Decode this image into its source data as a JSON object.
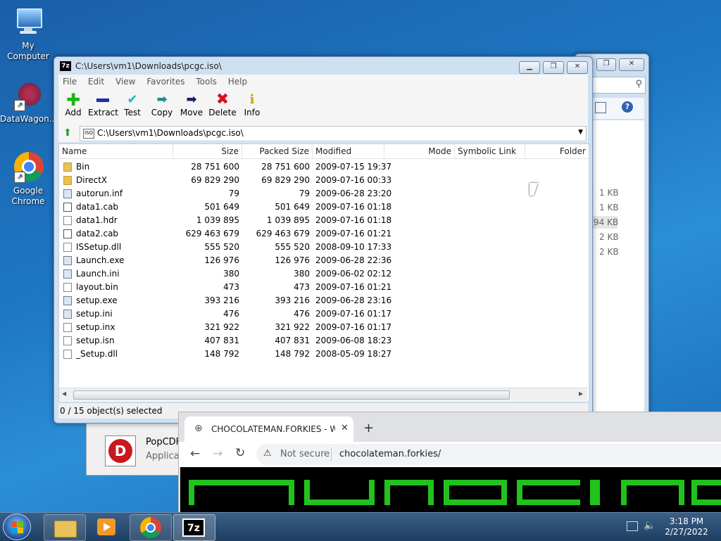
{
  "desktop": {
    "icons": [
      {
        "label": "My Computer"
      },
      {
        "label": "DataWagon..."
      },
      {
        "label": "Google Chrome"
      }
    ]
  },
  "back_window": {
    "sizes": [
      "1 KB",
      "1 KB",
      "94 KB",
      "2 KB",
      "2 KB"
    ]
  },
  "behind_item": {
    "name": "PopCDF",
    "type": "Applicat"
  },
  "sevenzip": {
    "title": "C:\\Users\\vm1\\Downloads\\pcgc.iso\\",
    "menu": [
      "File",
      "Edit",
      "View",
      "Favorites",
      "Tools",
      "Help"
    ],
    "toolbar": [
      "Add",
      "Extract",
      "Test",
      "Copy",
      "Move",
      "Delete",
      "Info"
    ],
    "address": "C:\\Users\\vm1\\Downloads\\pcgc.iso\\",
    "columns": [
      "Name",
      "Size",
      "Packed Size",
      "Modified",
      "Mode",
      "Symbolic Link",
      "Folder"
    ],
    "rows": [
      {
        "name": "Bin",
        "size": "28 751 600",
        "packed": "28 751 600",
        "modified": "2009-07-15 19:37",
        "icon": "folder"
      },
      {
        "name": "DirectX",
        "size": "69 829 290",
        "packed": "69 829 290",
        "modified": "2009-07-16 00:33",
        "icon": "folder"
      },
      {
        "name": "autorun.inf",
        "size": "79",
        "packed": "79",
        "modified": "2009-06-28 23:20",
        "icon": "exe"
      },
      {
        "name": "data1.cab",
        "size": "501 649",
        "packed": "501 649",
        "modified": "2009-07-16 01:18",
        "icon": "cab"
      },
      {
        "name": "data1.hdr",
        "size": "1 039 895",
        "packed": "1 039 895",
        "modified": "2009-07-16 01:18",
        "icon": "file"
      },
      {
        "name": "data2.cab",
        "size": "629 463 679",
        "packed": "629 463 679",
        "modified": "2009-07-16 01:21",
        "icon": "cab"
      },
      {
        "name": "ISSetup.dll",
        "size": "555 520",
        "packed": "555 520",
        "modified": "2008-09-10 17:33",
        "icon": "file"
      },
      {
        "name": "Launch.exe",
        "size": "126 976",
        "packed": "126 976",
        "modified": "2009-06-28 22:36",
        "icon": "exe"
      },
      {
        "name": "Launch.ini",
        "size": "380",
        "packed": "380",
        "modified": "2009-06-02 02:12",
        "icon": "exe"
      },
      {
        "name": "layout.bin",
        "size": "473",
        "packed": "473",
        "modified": "2009-07-16 01:21",
        "icon": "file"
      },
      {
        "name": "setup.exe",
        "size": "393 216",
        "packed": "393 216",
        "modified": "2009-06-28 23:16",
        "icon": "exe"
      },
      {
        "name": "setup.ini",
        "size": "476",
        "packed": "476",
        "modified": "2009-07-16 01:17",
        "icon": "exe"
      },
      {
        "name": "setup.inx",
        "size": "321 922",
        "packed": "321 922",
        "modified": "2009-07-16 01:17",
        "icon": "file"
      },
      {
        "name": "setup.isn",
        "size": "407 831",
        "packed": "407 831",
        "modified": "2009-06-08 18:23",
        "icon": "file"
      },
      {
        "name": "_Setup.dll",
        "size": "148 792",
        "packed": "148 792",
        "modified": "2008-05-09 18:27",
        "icon": "file"
      }
    ],
    "status": "0 / 15 object(s) selected"
  },
  "chrome": {
    "tab_title": "CHOCOLATEMAN.FORKIES - WE",
    "not_secure": "Not secure",
    "url": "chocolateman.forkies/"
  },
  "taskbar": {
    "time": "3:18 PM",
    "date": "2/27/2022",
    "sevenzip_label": "7z"
  },
  "colors": {
    "banner_green": "#22c21e",
    "accent_blue": "#1f78c4"
  }
}
